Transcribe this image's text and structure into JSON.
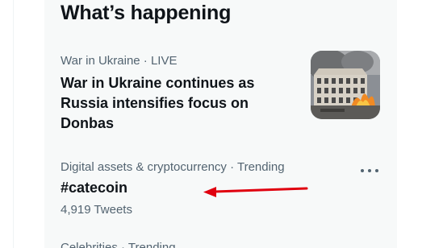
{
  "section": {
    "title": "What’s happening"
  },
  "trends": [
    {
      "meta": "War in Ukraine · LIVE",
      "headline": "War in Ukraine continues as Russia intensifies focus on Donbas",
      "thumbnail_icon": "burning-building-photo"
    },
    {
      "meta": "Digital assets & cryptocurrency · Trending",
      "tag": "#catecoin",
      "count": "4,919 Tweets",
      "more_icon": "more-options-icon"
    },
    {
      "meta": "Celebrities · Trending"
    }
  ],
  "annotation": {
    "color": "#e0000f",
    "icon": "red-arrow"
  }
}
